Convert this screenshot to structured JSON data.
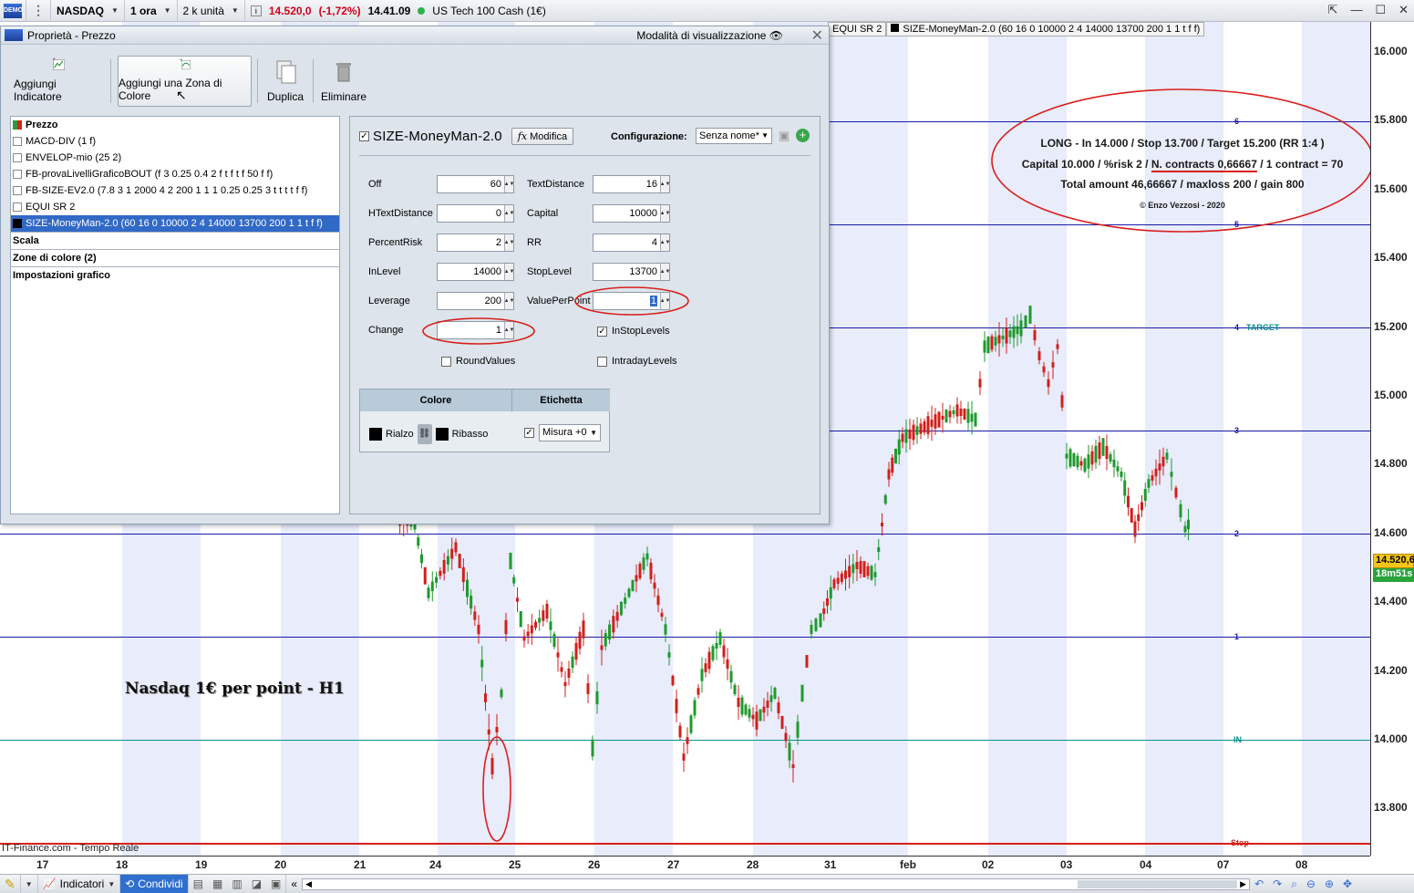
{
  "topbar": {
    "symbol": "NASDAQ",
    "timeframe": "1 ora",
    "units": "2 k unità",
    "price": "14.520,0",
    "change": "(-1,72%)",
    "time": "14.41.09",
    "instrument": "US Tech 100 Cash (1€)"
  },
  "header_tabs": [
    "EQUI SR 2",
    "SIZE-MoneyMan-2.0 (60 16 0 10000 2 4 14000 13700 200 1 1 t f f)"
  ],
  "dialog": {
    "title": "Proprietà - Prezzo",
    "mode": "Modalità di visualizzazione",
    "toolbar": {
      "add_indicator": "Aggiungi Indicatore",
      "add_zone": "Aggiungi una Zona di Colore",
      "duplicate": "Duplica",
      "delete": "Eliminare"
    },
    "list": {
      "head": "Prezzo",
      "items": [
        "MACD-DIV (1 f)",
        "ENVELOP-mio (25 2)",
        "FB-provaLivelliGraficoBOUT (f 3 0.25 0.4 2 f t f t f 50 f f)",
        "FB-SIZE-EV2.0 (7.8 3 1 2000 4 2 200 1 1 1 0.25 0.25 3 t t t t f f)",
        "EQUI SR 2",
        "SIZE-MoneyMan-2.0 (60 16 0 10000 2 4 14000 13700 200 1 1 t f f)"
      ],
      "sections": [
        "Scala",
        "Zone di colore (2)",
        "Impostazioni grafico"
      ]
    },
    "panel": {
      "title": "SIZE-MoneyMan-2.0",
      "edit": "Modifica",
      "config_label": "Configurazione:",
      "config_value": "Senza nome*",
      "params": {
        "off_l": "Off",
        "off_v": "60",
        "td_l": "TextDistance",
        "td_v": "16",
        "htd_l": "HTextDistance",
        "htd_v": "0",
        "cap_l": "Capital",
        "cap_v": "10000",
        "pr_l": "PercentRisk",
        "pr_v": "2",
        "rr_l": "RR",
        "rr_v": "4",
        "in_l": "InLevel",
        "in_v": "14000",
        "st_l": "StopLevel",
        "st_v": "13700",
        "lev_l": "Leverage",
        "lev_v": "200",
        "vpp_l": "ValuePerPoint",
        "vpp_v": "1",
        "chg_l": "Change",
        "chg_v": "1"
      },
      "checks": {
        "instop": "InStopLevels",
        "round": "RoundValues",
        "intraday": "IntradayLevels"
      },
      "table": {
        "col1": "Colore",
        "col2": "Etichetta",
        "up": "Rialzo",
        "down": "Ribasso",
        "measure": "Misura +0"
      }
    }
  },
  "chart": {
    "info": {
      "l1": "LONG - In 14.000  / Stop 13.700  / Target 15.200  (RR 1:4 )",
      "l2a": "Capital 10.000  / %risk 2  / ",
      "l2b": "N. contracts 0,66667",
      "l2c": "  / 1 contract = 70",
      "l3": "Total amount 46,66667  / maxloss 200  / gain 800",
      "l4": "© Enzo Vezzosi - 2020"
    },
    "caption": "Nasdaq 1€ per point - H1",
    "source": "IT-Finance.com - Tempo Reale",
    "price_tag": "14.520,6",
    "time_tag": "18m51s",
    "levels": {
      "l6": "6",
      "l5": "5",
      "l4": "4",
      "target": "TARGET",
      "l3": "3",
      "l2": "2",
      "l1": "1",
      "in": "IN",
      "stop": "Stop"
    },
    "yticks": [
      "16.000",
      "15.800",
      "15.600",
      "15.400",
      "15.200",
      "15.000",
      "14.800",
      "14.600",
      "14.400",
      "14.200",
      "14.000",
      "13.800"
    ],
    "xticks": [
      "17",
      "18",
      "19",
      "20",
      "21",
      "24",
      "25",
      "26",
      "27",
      "28",
      "31",
      "feb",
      "02",
      "03",
      "04",
      "07",
      "08"
    ]
  },
  "bottombar": {
    "indicators": "Indicatori",
    "share": "Condividi"
  },
  "colors": {
    "level": "#1a1aa8",
    "stop": "#d8201c",
    "in": "#0a8f8f",
    "annotation": "#d8201c",
    "band": "#e8ecfb"
  }
}
